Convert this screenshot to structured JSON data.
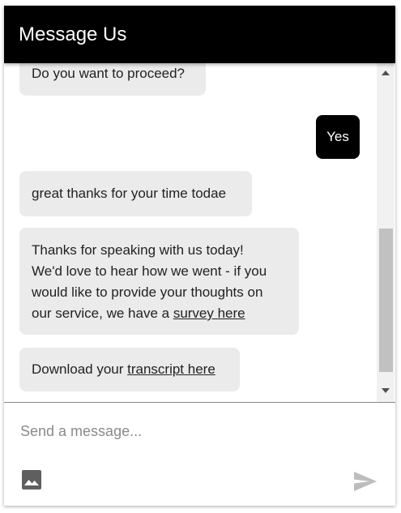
{
  "header": {
    "title": "Message Us"
  },
  "messages": [
    {
      "from": "agent",
      "text": "Do you want to proceed?"
    },
    {
      "from": "user",
      "text": "Yes"
    },
    {
      "from": "agent",
      "text": "great thanks for your time todae"
    },
    {
      "from": "agent",
      "lines": [
        "Thanks for speaking with us today!",
        "We'd love to hear how we went - if you",
        "would like to provide your thoughts on"
      ],
      "last_prefix": "our service, we have a ",
      "link_text": "survey here"
    },
    {
      "from": "agent",
      "prefix": "Download your ",
      "link_text": "transcript here"
    }
  ],
  "composer": {
    "placeholder": "Send a message..."
  },
  "icons": {
    "attach": "image-icon",
    "send": "send-icon",
    "scroll_up": "caret-up-icon",
    "scroll_down": "caret-down-icon"
  },
  "colors": {
    "header_bg": "#000000",
    "user_bubble": "#000000",
    "agent_bubble": "#ebebeb"
  }
}
